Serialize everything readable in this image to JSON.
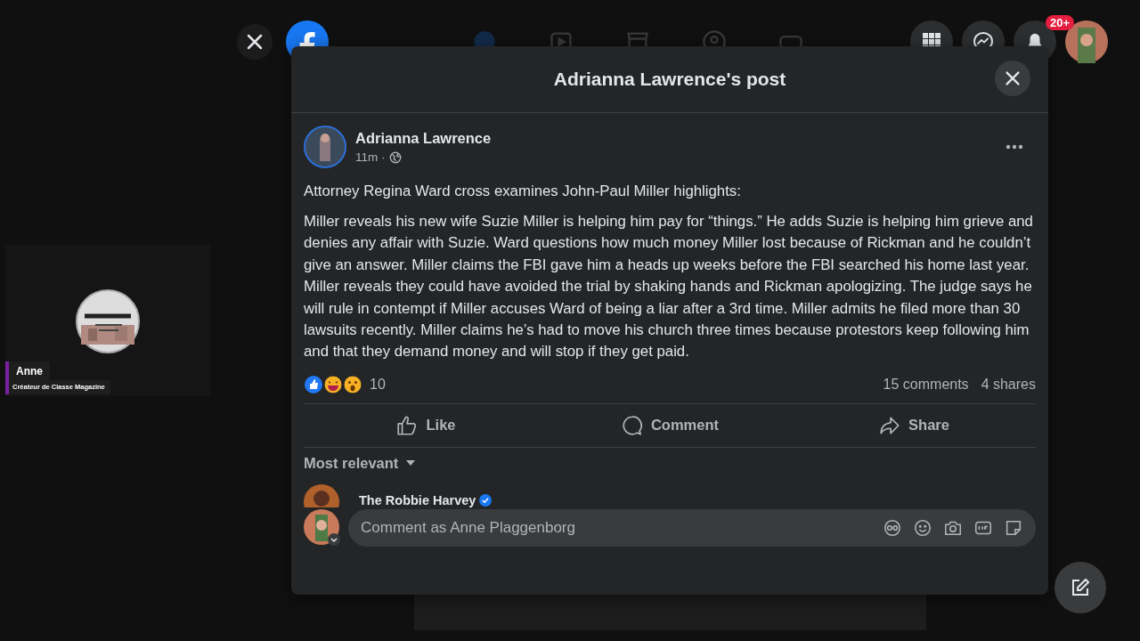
{
  "presenter": {
    "name": "Anne",
    "subtitle": "Créateur de Classe Magazine"
  },
  "top_bar": {
    "notification_count": "20+"
  },
  "post_dialog": {
    "title": "Adrianna Lawrence's post",
    "author": "Adrianna Lawrence",
    "time": "11m",
    "separator": "·",
    "heading": "Attorney Regina Ward cross examines John-Paul Miller highlights:",
    "body": "Miller reveals his new wife Suzie Miller is helping him pay for “things.” He adds Suzie is helping him grieve and denies any affair with Suzie. Ward questions how much money Miller lost because of Rickman and he couldn’t give an answer. Miller claims the FBI gave him a heads up weeks before the FBI searched his home last year. Miller reveals they could have avoided the trial by shaking hands and Rickman apologizing. The judge says he will rule in contempt if Miller accuses Ward of being a liar after a 3rd time. Miller admits he filed more than 30 lawsuits recently. Miller claims he’s had to move his church three times because protestors keep following him and that they demand money and will stop if they get paid.",
    "reaction_count": "10",
    "comments": "15 comments",
    "shares": "4 shares",
    "actions": [
      {
        "label": "Like",
        "kind": "like"
      },
      {
        "label": "Comment",
        "kind": "comment"
      },
      {
        "label": "Share",
        "kind": "share"
      }
    ],
    "sort": "Most relevant",
    "comment_list": [
      {
        "author": "The Robbie Harvey",
        "verified": true
      }
    ],
    "composer": {
      "placeholder": "Comment as Anne Plaggenborg"
    }
  }
}
